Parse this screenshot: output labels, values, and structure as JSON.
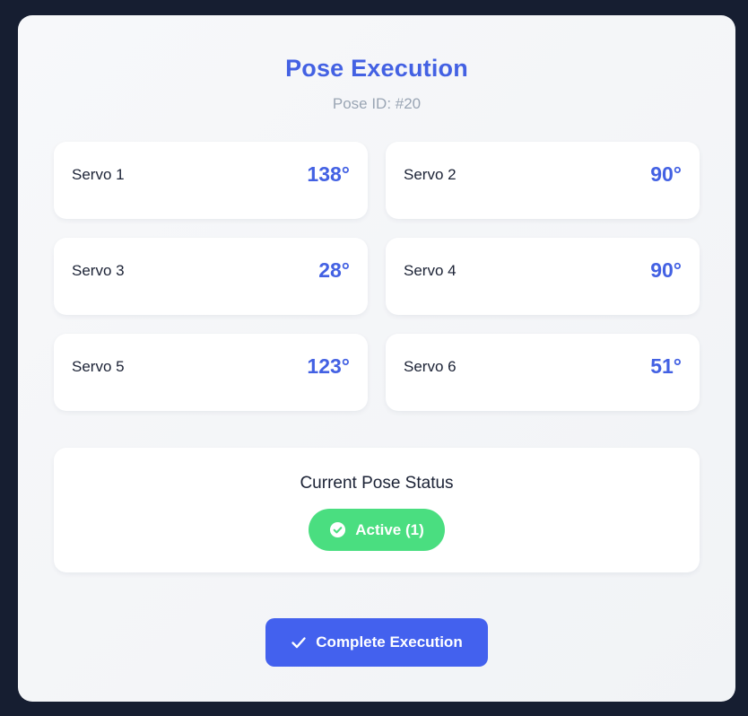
{
  "header": {
    "title": "Pose Execution",
    "pose_id": "Pose ID: #20"
  },
  "servos": [
    {
      "label": "Servo 1",
      "angle": "138°"
    },
    {
      "label": "Servo 2",
      "angle": "90°"
    },
    {
      "label": "Servo 3",
      "angle": "28°"
    },
    {
      "label": "Servo 4",
      "angle": "90°"
    },
    {
      "label": "Servo 5",
      "angle": "123°"
    },
    {
      "label": "Servo 6",
      "angle": "51°"
    }
  ],
  "status": {
    "title": "Current Pose Status",
    "badge": "Active (1)",
    "badge_icon": "check-circle-icon",
    "badge_color": "#4ade80"
  },
  "actions": {
    "complete_label": "Complete Execution",
    "complete_icon": "check-icon",
    "complete_color": "#4361ee"
  },
  "colors": {
    "accent": "#4361e3",
    "background": "#161e31",
    "card": "#ffffff"
  }
}
